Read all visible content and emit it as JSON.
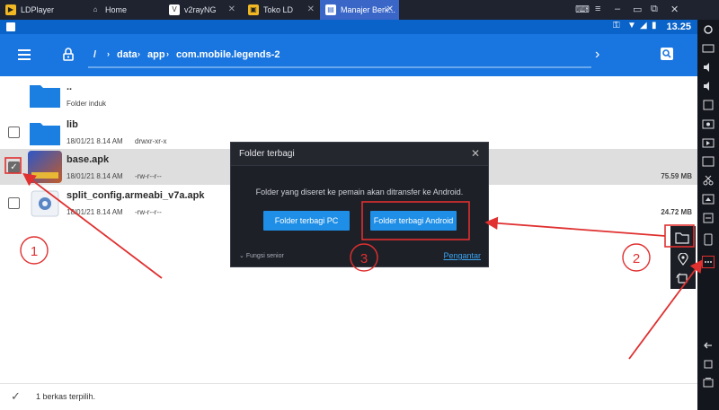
{
  "titlebar": {
    "app_name": "LDPlayer",
    "tabs": [
      {
        "label": "Home"
      },
      {
        "label": "v2rayNG"
      },
      {
        "label": "Toko LD"
      },
      {
        "label": "Manajer Berk..."
      }
    ]
  },
  "statusbar": {
    "time": "13.25"
  },
  "toolbar": {
    "path": [
      "/",
      "data",
      "app",
      "com.mobile.legends-2"
    ]
  },
  "files": [
    {
      "name": "..",
      "meta": "Folder induk",
      "perm": "",
      "size": ""
    },
    {
      "name": "lib",
      "meta": "18/01/21 8.14 AM",
      "perm": "drwxr-xr-x",
      "size": ""
    },
    {
      "name": "base.apk",
      "meta": "18/01/21 8.14 AM",
      "perm": "-rw-r--r--",
      "size": "75.59 MB"
    },
    {
      "name": "split_config.armeabi_v7a.apk",
      "meta": "18/01/21 8.14 AM",
      "perm": "-rw-r--r--",
      "size": "24.72 MB"
    }
  ],
  "bottombar": {
    "selection": "1 berkas terpilih."
  },
  "modal": {
    "title": "Folder terbagi",
    "description": "Folder yang diseret ke pemain akan ditransfer ke Android.",
    "btn_pc": "Folder terbagi PC",
    "btn_android": "Folder terbagi Android",
    "senior": "Fungsi senior",
    "settings": "Pengantar"
  },
  "annotations": {
    "n1": "1",
    "n2": "2",
    "n3": "3"
  },
  "colors": {
    "toolbar": "#1976e0",
    "statusbar": "#0a63c9",
    "annotation": "#e03030",
    "button": "#1e8ee6"
  }
}
